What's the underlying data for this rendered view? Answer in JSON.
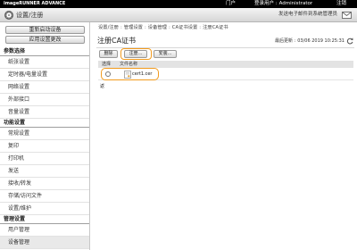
{
  "header": {
    "brand": "imageRUNNER ADVANCE",
    "portal_link": "门户",
    "login_label": "登录用户 :",
    "login_user": "Administrator",
    "logout_link": "注销",
    "section_title": "设置/注册",
    "mail_admin_link": "发送电子邮件到系统管理员"
  },
  "sidebar": {
    "buttons": {
      "restart": "重新启动设备",
      "apply": "应用设置更改"
    },
    "groups": [
      {
        "title": "参数选择",
        "items": [
          {
            "label": "纸张设置"
          },
          {
            "label": "定时器/电量设置"
          },
          {
            "label": "网络设置"
          },
          {
            "label": "外部接口"
          },
          {
            "label": "音量设置"
          }
        ]
      },
      {
        "title": "功能设置",
        "items": [
          {
            "label": "常规设置"
          },
          {
            "label": "复印"
          },
          {
            "label": "打印机"
          },
          {
            "label": "发送"
          },
          {
            "label": "接收/转发"
          },
          {
            "label": "存储/访问文件"
          },
          {
            "label": "设置/维护"
          }
        ]
      },
      {
        "title": "管理设置",
        "items": [
          {
            "label": "用户管理"
          },
          {
            "label": "设备管理",
            "active": true
          }
        ]
      }
    ]
  },
  "main": {
    "breadcrumb": {
      "items": [
        "设置/注册",
        "管理设置",
        "设备管理",
        "CA证书设置",
        "注册CA证书"
      ],
      "separator": ":"
    },
    "title": "注册CA证书",
    "last_updated": {
      "label": "最后更新 :",
      "value": "03/06 2019 10:25:31"
    },
    "toolbar": {
      "delete": "删除",
      "register": "注册...",
      "install": "安装..."
    },
    "table": {
      "headers": {
        "select": "选择",
        "file_name": "文件名称"
      },
      "rows": [
        {
          "file_name": "cert1.cer",
          "selected": false
        }
      ]
    },
    "back_link": "返"
  },
  "colors": {
    "top_bar": "#000000",
    "highlight_ring": "#f29b1e",
    "table_header": "#e3e3e3"
  },
  "icons": {
    "header": "gear-icon",
    "mail": "mail-icon",
    "refresh": "refresh-icon",
    "file": "certificate-file-icon"
  }
}
